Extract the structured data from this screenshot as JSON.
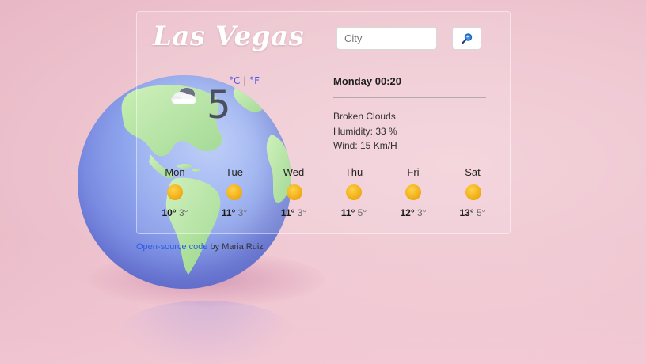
{
  "city": "Las Vegas",
  "search": {
    "placeholder": "City"
  },
  "units": {
    "celsius": "°C",
    "separator": "|",
    "fahrenheit": "°F"
  },
  "current": {
    "temperature": "5",
    "date_time": "Monday 00:20",
    "description": "Broken Clouds",
    "humidity": "Humidity: 33 %",
    "wind": "Wind: 15 Km/H"
  },
  "forecast": [
    {
      "day": "Mon",
      "max": "10°",
      "min": "3°",
      "icon": "sun-icon"
    },
    {
      "day": "Tue",
      "max": "11°",
      "min": "3°",
      "icon": "sun-icon"
    },
    {
      "day": "Wed",
      "max": "11°",
      "min": "3°",
      "icon": "sun-icon"
    },
    {
      "day": "Thu",
      "max": "11°",
      "min": "5°",
      "icon": "sun-icon"
    },
    {
      "day": "Fri",
      "max": "12°",
      "min": "3°",
      "icon": "sun-icon"
    },
    {
      "day": "Sat",
      "max": "13°",
      "min": "5°",
      "icon": "sun-icon"
    }
  ],
  "footer": {
    "link_text": "Open-source code",
    "suffix": " by Maria Ruiz"
  },
  "icons": {
    "current_weather": "broken-clouds-icon",
    "search": "magnifier-icon"
  },
  "colors": {
    "accent": "#4a56e0",
    "link": "#2a5fe0",
    "sun": "#f2b21b",
    "title": "#ffffff"
  }
}
